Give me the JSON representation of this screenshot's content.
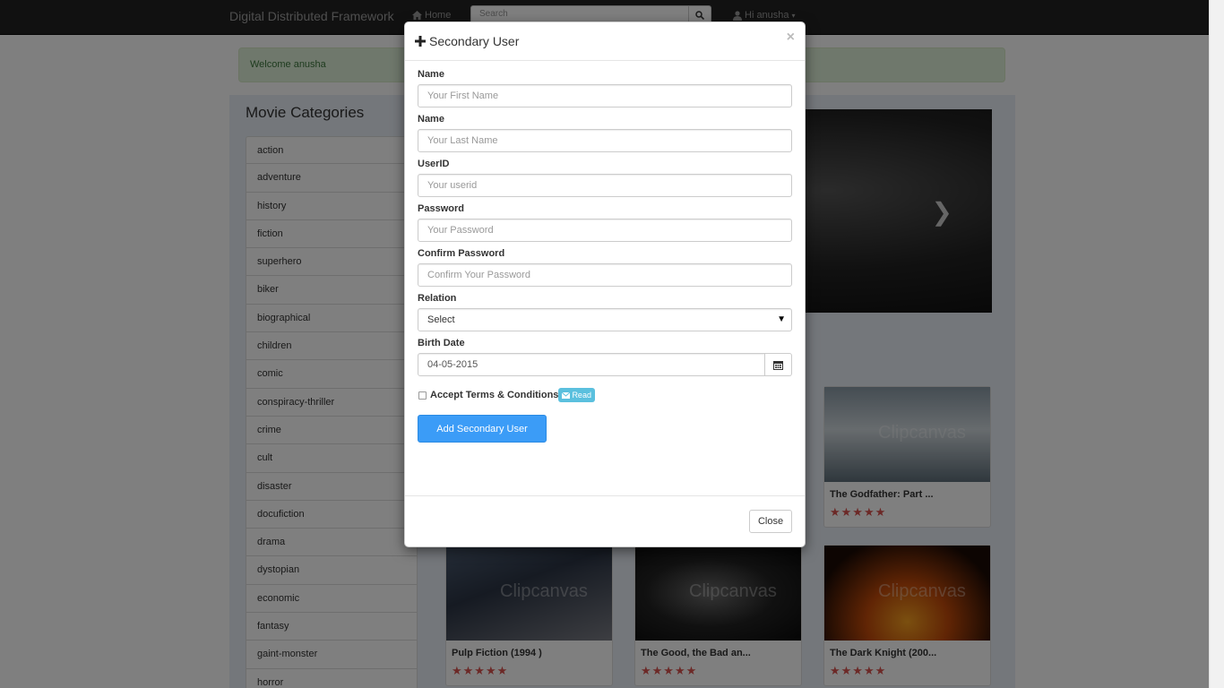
{
  "navbar": {
    "brand": "Digital Distributed Framework",
    "home_label": "Home",
    "search_placeholder": "Search",
    "user_label": "Hi anusha"
  },
  "alert": {
    "text": "Welcome anusha"
  },
  "sidebar": {
    "title": "Movie Categories",
    "categories": [
      "action",
      "adventure",
      "history",
      "fiction",
      "superhero",
      "biker",
      "biographical",
      "children",
      "comic",
      "conspiracy-thriller",
      "crime",
      "cult",
      "disaster",
      "docufiction",
      "drama",
      "dystopian",
      "economic",
      "fantasy",
      "gaint-monster",
      "horror"
    ]
  },
  "movies": [
    {
      "title": "The Godfather: Part ...",
      "stars": "★★★★★",
      "watermark": "Clipcanvas"
    },
    {
      "title": "Pulp Fiction (1994 )",
      "stars": "★★★★★",
      "watermark": "Clipcanvas"
    },
    {
      "title": "The Good, the Bad an...",
      "stars": "★★★★★",
      "watermark": "Clipcanvas"
    },
    {
      "title": "The Dark Knight (200...",
      "stars": "★★★★★",
      "watermark": "Clipcanvas"
    }
  ],
  "modal": {
    "title": "Secondary User",
    "close_x": "×",
    "fields": {
      "first_name": {
        "label": "Name",
        "placeholder": "Your First Name"
      },
      "last_name": {
        "label": "Name",
        "placeholder": "Your Last Name"
      },
      "userid": {
        "label": "UserID",
        "placeholder": "Your userid"
      },
      "password": {
        "label": "Password",
        "placeholder": "Your Password"
      },
      "confirm_password": {
        "label": "Confirm Password",
        "placeholder": "Confirm Your Password"
      },
      "relation": {
        "label": "Relation",
        "value": "Select"
      },
      "birth_date": {
        "label": "Birth Date",
        "value": "04-05-2015"
      }
    },
    "terms_label": "Accept Terms & Conditions",
    "read_label": "Read",
    "submit_label": "Add Secondary User",
    "close_label": "Close"
  },
  "icons": {
    "home": "home-icon",
    "search": "search-icon",
    "user": "user-icon",
    "plus": "plus-icon",
    "calendar": "calendar-icon",
    "envelope": "envelope-icon",
    "carousel_next": "chevron-right-icon"
  },
  "colors": {
    "navbar": "#222222",
    "primary_button": "#3b9cf7",
    "info_badge": "#5bc0de",
    "alert_bg": "#dff0d8",
    "stars": "#d9534f"
  }
}
